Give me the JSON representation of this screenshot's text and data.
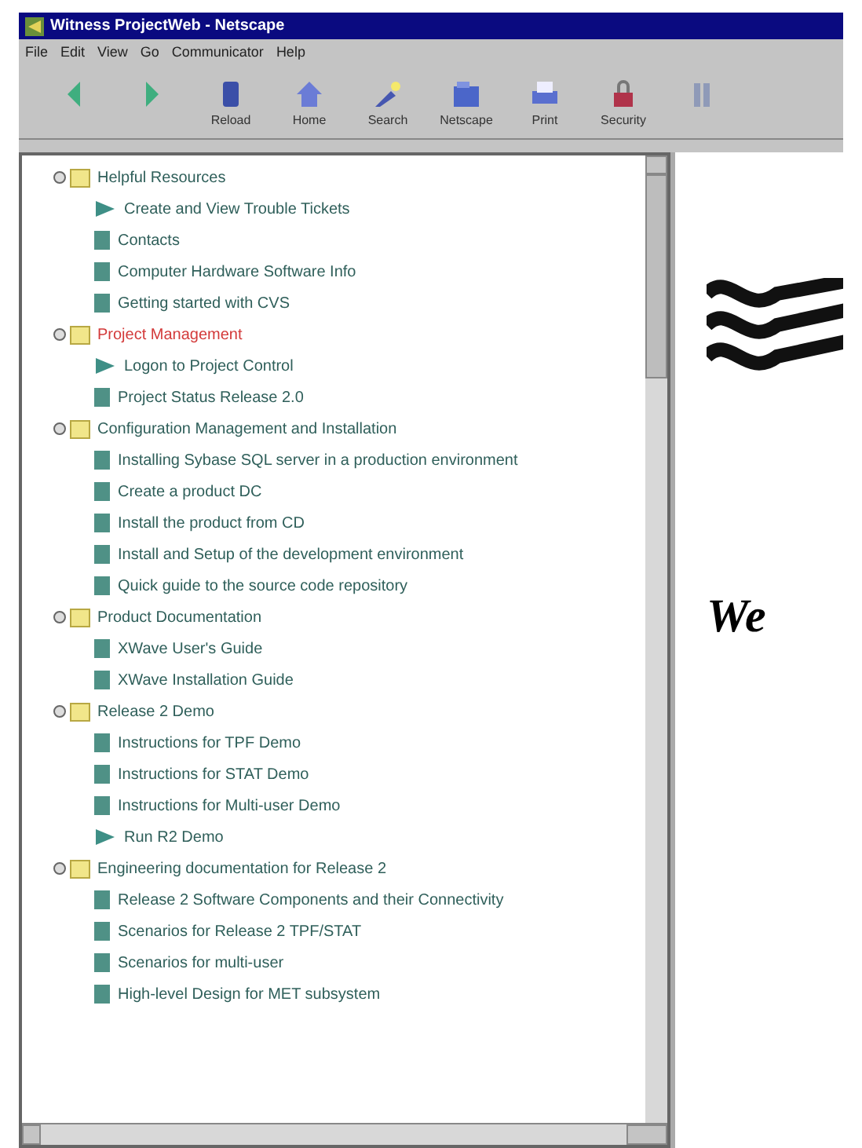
{
  "window": {
    "title": "Witness ProjectWeb - Netscape"
  },
  "menu": [
    "File",
    "Edit",
    "View",
    "Go",
    "Communicator",
    "Help"
  ],
  "toolbar": [
    {
      "kind": "back"
    },
    {
      "kind": "forward"
    },
    {
      "kind": "reload",
      "label": "Reload"
    },
    {
      "kind": "home",
      "label": "Home"
    },
    {
      "kind": "search",
      "label": "Search"
    },
    {
      "kind": "netscape",
      "label": "Netscape"
    },
    {
      "kind": "print",
      "label": "Print"
    },
    {
      "kind": "security",
      "label": "Security"
    },
    {
      "kind": "stop"
    }
  ],
  "tree": [
    {
      "label": "Helpful Resources",
      "highlighted": false,
      "children": [
        {
          "kind": "arrow",
          "label": "Create and View Trouble Tickets"
        },
        {
          "kind": "doc",
          "label": "Contacts"
        },
        {
          "kind": "doc",
          "label": "Computer Hardware Software Info"
        },
        {
          "kind": "doc",
          "label": "Getting started with CVS"
        }
      ]
    },
    {
      "label": "Project Management",
      "highlighted": true,
      "children": [
        {
          "kind": "arrow",
          "label": "Logon to Project Control"
        },
        {
          "kind": "doc",
          "label": "Project Status Release 2.0"
        }
      ]
    },
    {
      "label": "Configuration Management and Installation",
      "highlighted": false,
      "children": [
        {
          "kind": "doc",
          "label": "Installing Sybase SQL server in a production environment"
        },
        {
          "kind": "doc",
          "label": "Create a product DC"
        },
        {
          "kind": "doc",
          "label": "Install the product from CD"
        },
        {
          "kind": "doc",
          "label": "Install and Setup of the development environment"
        },
        {
          "kind": "doc",
          "label": "Quick guide to the source code repository"
        }
      ]
    },
    {
      "label": "Product Documentation",
      "highlighted": false,
      "children": [
        {
          "kind": "doc",
          "label": "XWave User's Guide"
        },
        {
          "kind": "doc",
          "label": "XWave Installation Guide"
        }
      ]
    },
    {
      "label": "Release 2 Demo",
      "highlighted": false,
      "children": [
        {
          "kind": "doc",
          "label": "Instructions for TPF Demo"
        },
        {
          "kind": "doc",
          "label": "Instructions for STAT Demo"
        },
        {
          "kind": "doc",
          "label": "Instructions for Multi-user Demo"
        },
        {
          "kind": "arrow",
          "label": "Run R2 Demo"
        }
      ]
    },
    {
      "label": "Engineering documentation for Release 2",
      "highlighted": false,
      "children": [
        {
          "kind": "doc",
          "label": "Release 2 Software Components and their Connectivity"
        },
        {
          "kind": "doc",
          "label": "Scenarios for Release 2 TPF/STAT"
        },
        {
          "kind": "doc",
          "label": "Scenarios for multi-user"
        },
        {
          "kind": "doc",
          "label": "High-level Design for MET subsystem"
        }
      ]
    }
  ],
  "content": {
    "heading": "We"
  }
}
